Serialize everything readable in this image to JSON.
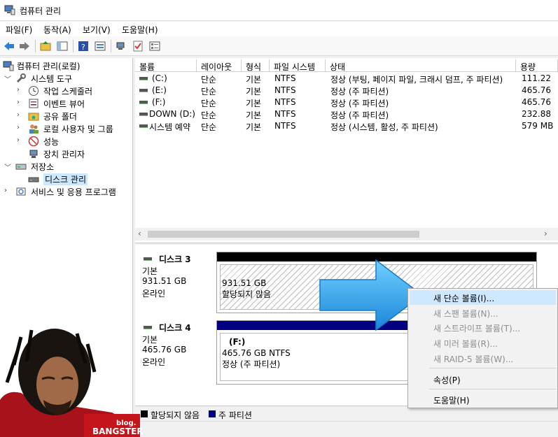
{
  "window": {
    "title": "컴퓨터 관리"
  },
  "menu": [
    "파일(F)",
    "동작(A)",
    "보기(V)",
    "도움말(H)"
  ],
  "toolbar": {
    "icons": [
      "back-arrow-icon",
      "forward-arrow-icon",
      "up-folder-icon",
      "show-hide-tree-icon",
      "help-icon",
      "properties-icon",
      "connect-icon",
      "check-icon",
      "view-icon"
    ]
  },
  "tree": {
    "root": "컴퓨터 관리(로컬)",
    "system_tools": "시스템 도구",
    "task_scheduler": "작업 스케줄러",
    "event_viewer": "이벤트 뷰어",
    "shared_folders": "공유 폴더",
    "local_users": "로컬 사용자 및 그룹",
    "performance": "성능",
    "device_manager": "장치 관리자",
    "storage": "저장소",
    "disk_management": "디스크 관리",
    "services": "서비스 및 응용 프로그램"
  },
  "volume_table": {
    "headers": [
      "볼륨",
      "레이아웃",
      "형식",
      "파일 시스템",
      "상태",
      "용량"
    ],
    "rows": [
      {
        "volume": "(C:)",
        "layout": "단순",
        "type": "기본",
        "fs": "NTFS",
        "status": "정상 (부팅, 페이지 파일, 크래시 덤프, 주 파티션)",
        "capacity": "111.22"
      },
      {
        "volume": "(E:)",
        "layout": "단순",
        "type": "기본",
        "fs": "NTFS",
        "status": "정상 (주 파티션)",
        "capacity": "465.76"
      },
      {
        "volume": "(F:)",
        "layout": "단순",
        "type": "기본",
        "fs": "NTFS",
        "status": "정상 (주 파티션)",
        "capacity": "465.76"
      },
      {
        "volume": "DOWN (D:)",
        "layout": "단순",
        "type": "기본",
        "fs": "NTFS",
        "status": "정상 (주 파티션)",
        "capacity": "232.88"
      },
      {
        "volume": "시스템 예약",
        "layout": "단순",
        "type": "기본",
        "fs": "NTFS",
        "status": "정상 (시스템, 활성, 주 파티션)",
        "capacity": "579 MB"
      }
    ]
  },
  "disks": {
    "disk3": {
      "name": "디스크 3",
      "kind": "기본",
      "size": "931.51 GB",
      "state": "온라인",
      "part_size": "931.51 GB",
      "part_status": "할당되지 않음"
    },
    "disk4": {
      "name": "디스크 4",
      "kind": "기본",
      "size": "465.76 GB",
      "state": "온라인",
      "part_letter": "(F:)",
      "part_size": "465.76 GB NTFS",
      "part_status": "정상 (주 파티션)"
    }
  },
  "legend": {
    "unallocated": "할당되지 않음",
    "primary": "주 파티션",
    "unallocated_color": "#000000",
    "primary_color": "#000080"
  },
  "context_menu": {
    "new_simple": "새 단순 볼륨(I)...",
    "new_spanned": "새 스팬 볼륨(N)...",
    "new_striped": "새 스트라이프 볼륨(T)...",
    "new_mirrored": "새 미러 볼륨(R)...",
    "new_raid5": "새 RAID-5 볼륨(W)...",
    "properties": "속성(P)",
    "help": "도움말(H)"
  },
  "watermark": {
    "line1": "blog.",
    "line2": "BANGSTER"
  }
}
